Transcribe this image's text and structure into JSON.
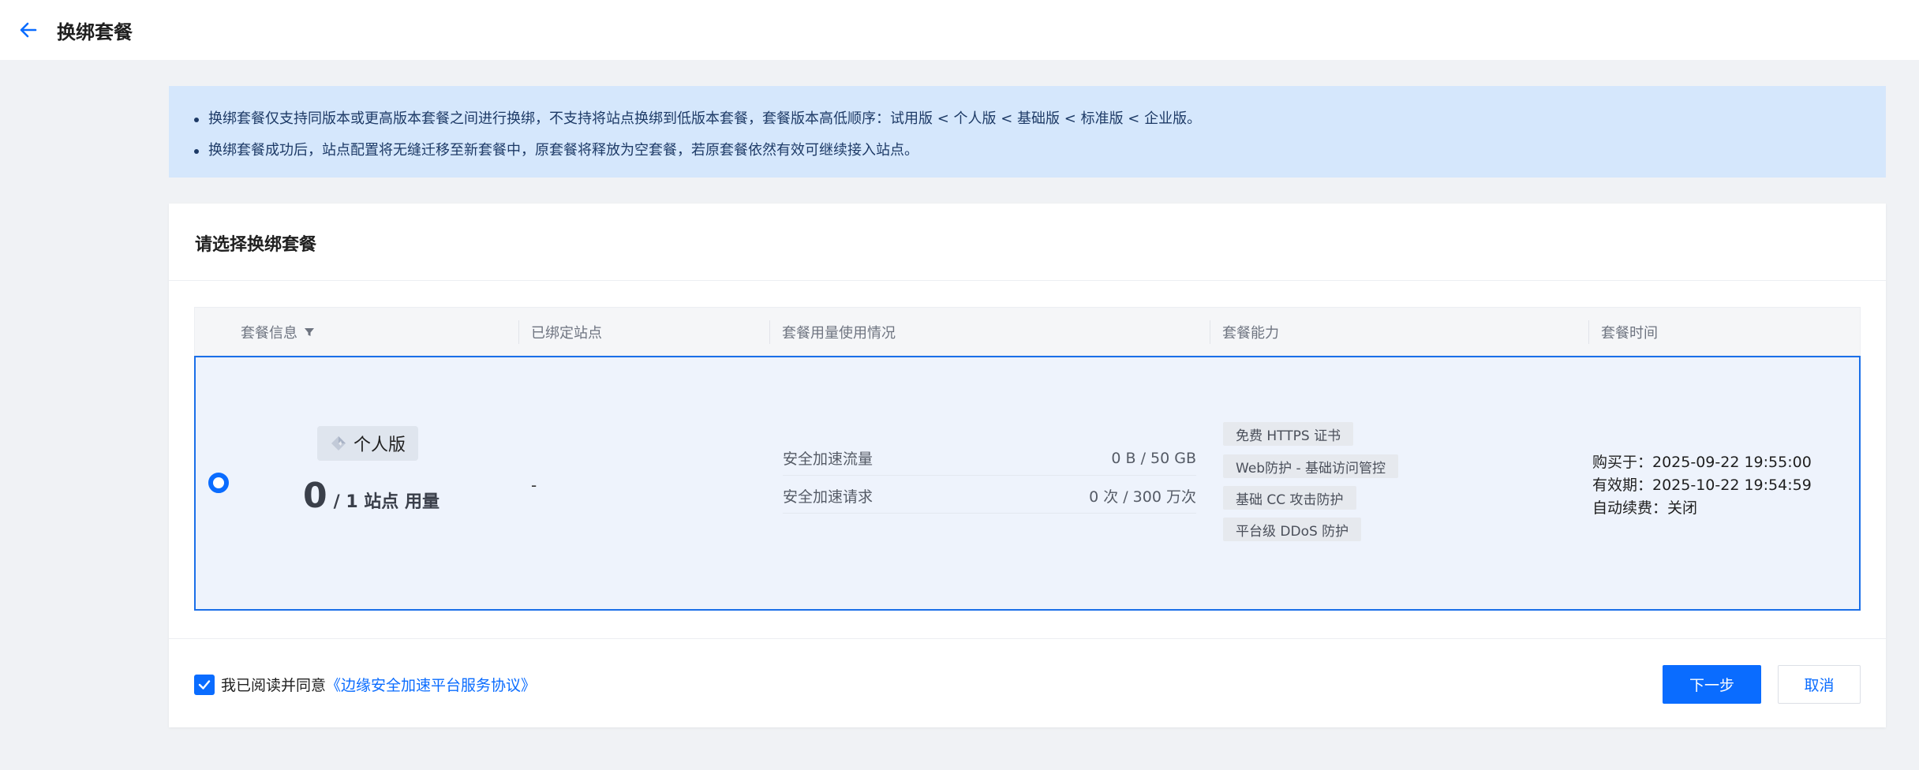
{
  "header": {
    "title": "换绑套餐",
    "back_icon": "arrow-left-icon"
  },
  "notice": {
    "lines": [
      "换绑套餐仅支持同版本或更高版本套餐之间进行换绑，不支持将站点换绑到低版本套餐，套餐版本高低顺序：试用版 < 个人版 < 基础版 < 标准版 < 企业版。",
      "换绑套餐成功后，站点配置将无缝迁移至新套餐中，原套餐将释放为空套餐，若原套餐依然有效可继续接入站点。"
    ]
  },
  "card": {
    "title": "请选择换绑套餐"
  },
  "table": {
    "columns": [
      "套餐信息",
      "已绑定站点",
      "套餐用量使用情况",
      "套餐能力",
      "套餐时间"
    ],
    "rows": [
      {
        "selected": true,
        "plan_name": "个人版",
        "plan_icon": "diamond-icon",
        "usage_count": "0",
        "usage_rest": "/ 1 站点 用量",
        "bound_sites": "-",
        "metrics": [
          {
            "label": "安全加速流量",
            "value": "0 B / 50 GB"
          },
          {
            "label": "安全加速请求",
            "value": "0 次 / 300 万次"
          }
        ],
        "abilities": [
          "免费 HTTPS 证书",
          "Web防护 - 基础访问管控",
          "基础 CC 攻击防护",
          "平台级 DDoS 防护"
        ],
        "times": [
          "购买于：2025-09-22 19:55:00",
          "有效期：2025-10-22 19:54:59",
          "自动续费：关闭"
        ]
      }
    ]
  },
  "footer": {
    "agree_prefix": "我已阅读并同意",
    "agree_link": "《边缘安全加速平台服务协议》",
    "agree_checked": true,
    "next_label": "下一步",
    "cancel_label": "取消"
  },
  "colors": {
    "accent": "#0a6cff",
    "notice_bg": "#d5e7fc",
    "selected_row_bg": "#eef3fc"
  }
}
